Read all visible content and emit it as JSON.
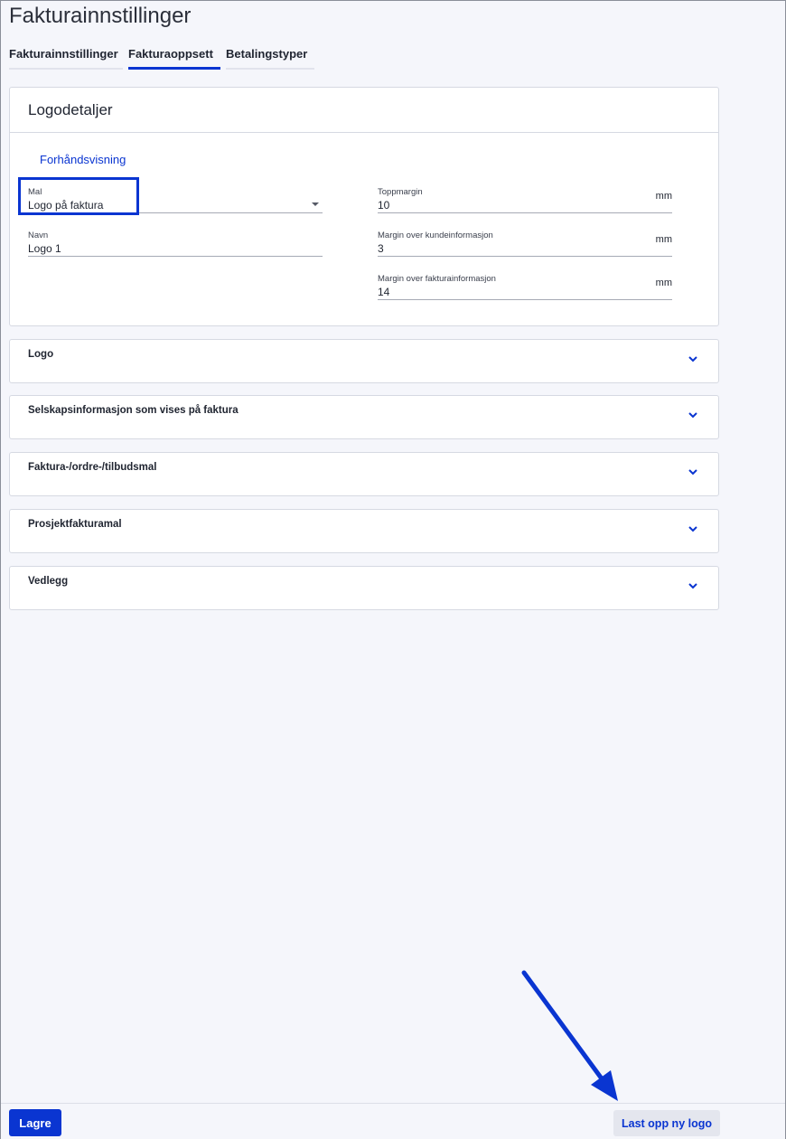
{
  "page": {
    "title": "Fakturainnstillinger"
  },
  "tabs": [
    {
      "label": "Fakturainnstillinger",
      "active": false
    },
    {
      "label": "Fakturaoppsett",
      "active": true
    },
    {
      "label": "Betalingstyper",
      "active": false
    }
  ],
  "logo_details": {
    "title": "Logodetaljer",
    "preview_link": "Forhåndsvisning",
    "template": {
      "label": "Mal",
      "value": "Logo på faktura"
    },
    "name": {
      "label": "Navn",
      "value": "Logo 1"
    },
    "top_margin": {
      "label": "Toppmargin",
      "value": "10",
      "unit": "mm"
    },
    "margin_customer": {
      "label": "Margin over kundeinformasjon",
      "value": "3",
      "unit": "mm"
    },
    "margin_invoice": {
      "label": "Margin over fakturainformasjon",
      "value": "14",
      "unit": "mm"
    }
  },
  "sections": [
    {
      "title": "Logo"
    },
    {
      "title": "Selskapsinformasjon som vises på faktura"
    },
    {
      "title": "Faktura-/ordre-/tilbudsmal"
    },
    {
      "title": "Prosjektfakturamal"
    },
    {
      "title": "Vedlegg"
    }
  ],
  "footer": {
    "save_label": "Lagre",
    "upload_label": "Last opp ny logo"
  },
  "colors": {
    "accent": "#0a35d1",
    "background": "#f5f6fb"
  },
  "icons": {
    "dropdown": "caret-down-icon",
    "section_toggle": "chevron-down-icon",
    "annotation": "arrow-icon"
  }
}
